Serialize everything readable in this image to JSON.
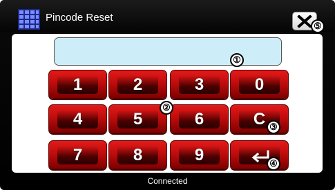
{
  "window": {
    "title": "Pincode Reset",
    "status": "Connected"
  },
  "pin_display": {
    "value": ""
  },
  "keypad": {
    "keys": [
      {
        "label": "1",
        "name": "key-1"
      },
      {
        "label": "2",
        "name": "key-2"
      },
      {
        "label": "3",
        "name": "key-3"
      },
      {
        "label": "0",
        "name": "key-0"
      },
      {
        "label": "4",
        "name": "key-4"
      },
      {
        "label": "5",
        "name": "key-5"
      },
      {
        "label": "6",
        "name": "key-6"
      },
      {
        "label": "C",
        "name": "key-clear"
      },
      {
        "label": "7",
        "name": "key-7"
      },
      {
        "label": "8",
        "name": "key-8"
      },
      {
        "label": "9",
        "name": "key-9"
      },
      {
        "label": "",
        "name": "key-enter",
        "icon": "enter-arrow-icon"
      }
    ]
  },
  "markers": [
    "①",
    "②",
    "③",
    "④",
    "⑤"
  ],
  "colors": {
    "key_red": "#c00c0c",
    "display_fill": "#cdeef8",
    "background": "#000000"
  }
}
